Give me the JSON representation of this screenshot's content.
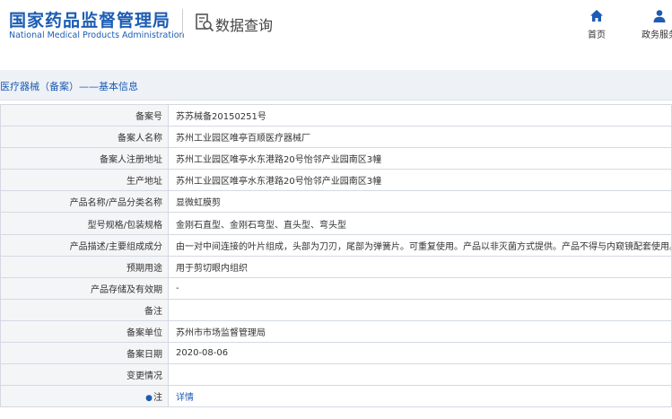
{
  "header": {
    "logo_cn": "国家药品监督管理局",
    "logo_en": "National Medical Products Administration",
    "query_title": "数据查询",
    "nav": {
      "home": "首页",
      "gov": "政务服务"
    }
  },
  "breadcrumb": "医疗器械（备案）——基本信息",
  "rows": [
    {
      "label": "备案号",
      "value": "苏苏械备20150251号"
    },
    {
      "label": "备案人名称",
      "value": "苏州工业园区唯亭百顺医疗器械厂"
    },
    {
      "label": "备案人注册地址",
      "value": "苏州工业园区唯亭水东港路20号怡邻产业园南区3幢"
    },
    {
      "label": "生产地址",
      "value": "苏州工业园区唯亭水东港路20号怡邻产业园南区3幢"
    },
    {
      "label": "产品名称/产品分类名称",
      "value": "显微虹膜剪"
    },
    {
      "label": "型号规格/包装规格",
      "value": "金刚石直型、金刚石弯型、直头型、弯头型"
    },
    {
      "label": "产品描述/主要组成成分",
      "value": "由一对中间连接的叶片组成，头部为刀刃，尾部为弹簧片。可重复使用。产品以非灭菌方式提供。产品不得与内窥镜配套使用。"
    },
    {
      "label": "预期用途",
      "value": "用于剪切眼内组织"
    },
    {
      "label": "产品存储及有效期",
      "value": "-"
    },
    {
      "label": "备注",
      "value": ""
    },
    {
      "label": "备案单位",
      "value": "苏州市市场监督管理局"
    },
    {
      "label": "备案日期",
      "value": "2020-08-06"
    },
    {
      "label": "变更情况",
      "value": ""
    },
    {
      "label": "注",
      "value": "详情"
    }
  ],
  "colors": {
    "brand_blue": "#1c5cb3",
    "label_bg": "#f4f5f7",
    "title_bar_bg": "#eef1f6"
  }
}
